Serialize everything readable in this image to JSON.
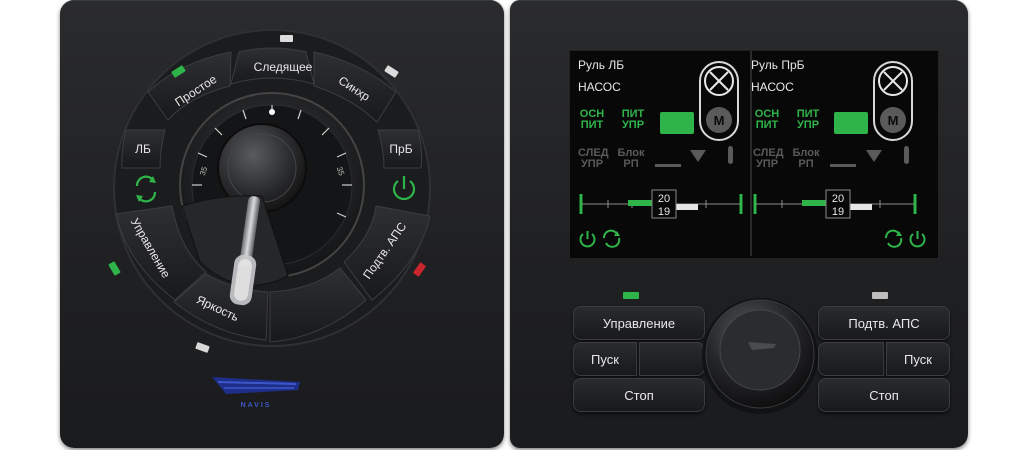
{
  "left_console": {
    "dial_buttons": {
      "simple": "Простое",
      "follow": "Следящее",
      "sync": "Синхр",
      "left_side": "ЛБ",
      "right_side": "ПрБ",
      "control": "Управление",
      "brightness": "Яркость",
      "confirm_aps": "Подтв. АПС"
    },
    "dial_scale": {
      "left_tick": "35",
      "right_tick": "35"
    },
    "logo_text": "NAVIS"
  },
  "screen": {
    "left_half": {
      "title": "Руль ЛБ",
      "subtitle": "НАСОС",
      "main_power": "ОСН ПИТ",
      "control_power": "ПИТ УПР",
      "follow_control": "СЛЕД УПР",
      "block_rp": "Блок РП",
      "motor_label": "M",
      "bar_top_value": "20",
      "bar_bottom_value": "19"
    },
    "right_half": {
      "title": "Руль ПрБ",
      "subtitle": "НАСОС",
      "main_power": "ОСН ПИТ",
      "control_power": "ПИТ УПР",
      "follow_control": "СЛЕД УПР",
      "block_rp": "Блок РП",
      "motor_label": "M",
      "bar_top_value": "20",
      "bar_bottom_value": "19"
    }
  },
  "right_console": {
    "left_buttons": {
      "control": "Управление",
      "start": "Пуск",
      "stop": "Стоп"
    },
    "right_buttons": {
      "confirm_aps": "Подтв. АПС",
      "start": "Пуск",
      "stop": "Стоп"
    }
  },
  "colors": {
    "green": "#2fb44a",
    "red": "#c8262c",
    "white_led": "#d8d8d8",
    "panel": "#222325"
  }
}
